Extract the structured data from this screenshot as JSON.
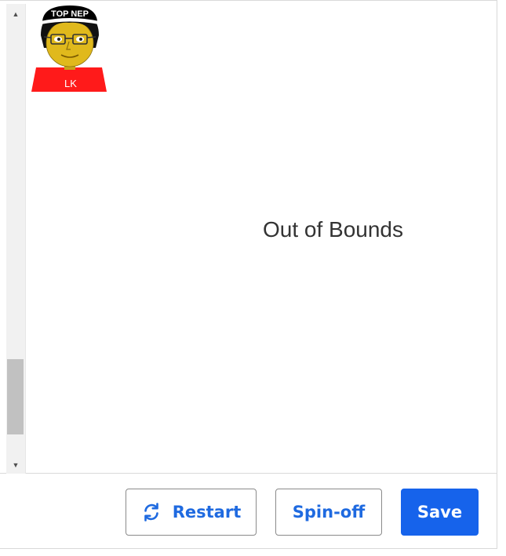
{
  "stage": {
    "message": "Out of Bounds",
    "sprite": {
      "cap_text": "TOP NEP",
      "shirt_text": "LK"
    }
  },
  "scrollbar": {
    "up_arrow": "▲",
    "down_arrow": "▼"
  },
  "footer": {
    "restart_label": "Restart",
    "restart_icon": "refresh-icon",
    "spinoff_label": "Spin-off",
    "save_label": "Save"
  },
  "colors": {
    "primary": "#1663eb",
    "link_blue": "#1f6ae0",
    "sprite_shirt": "#ff1a1a",
    "sprite_face": "#e0b91c"
  }
}
